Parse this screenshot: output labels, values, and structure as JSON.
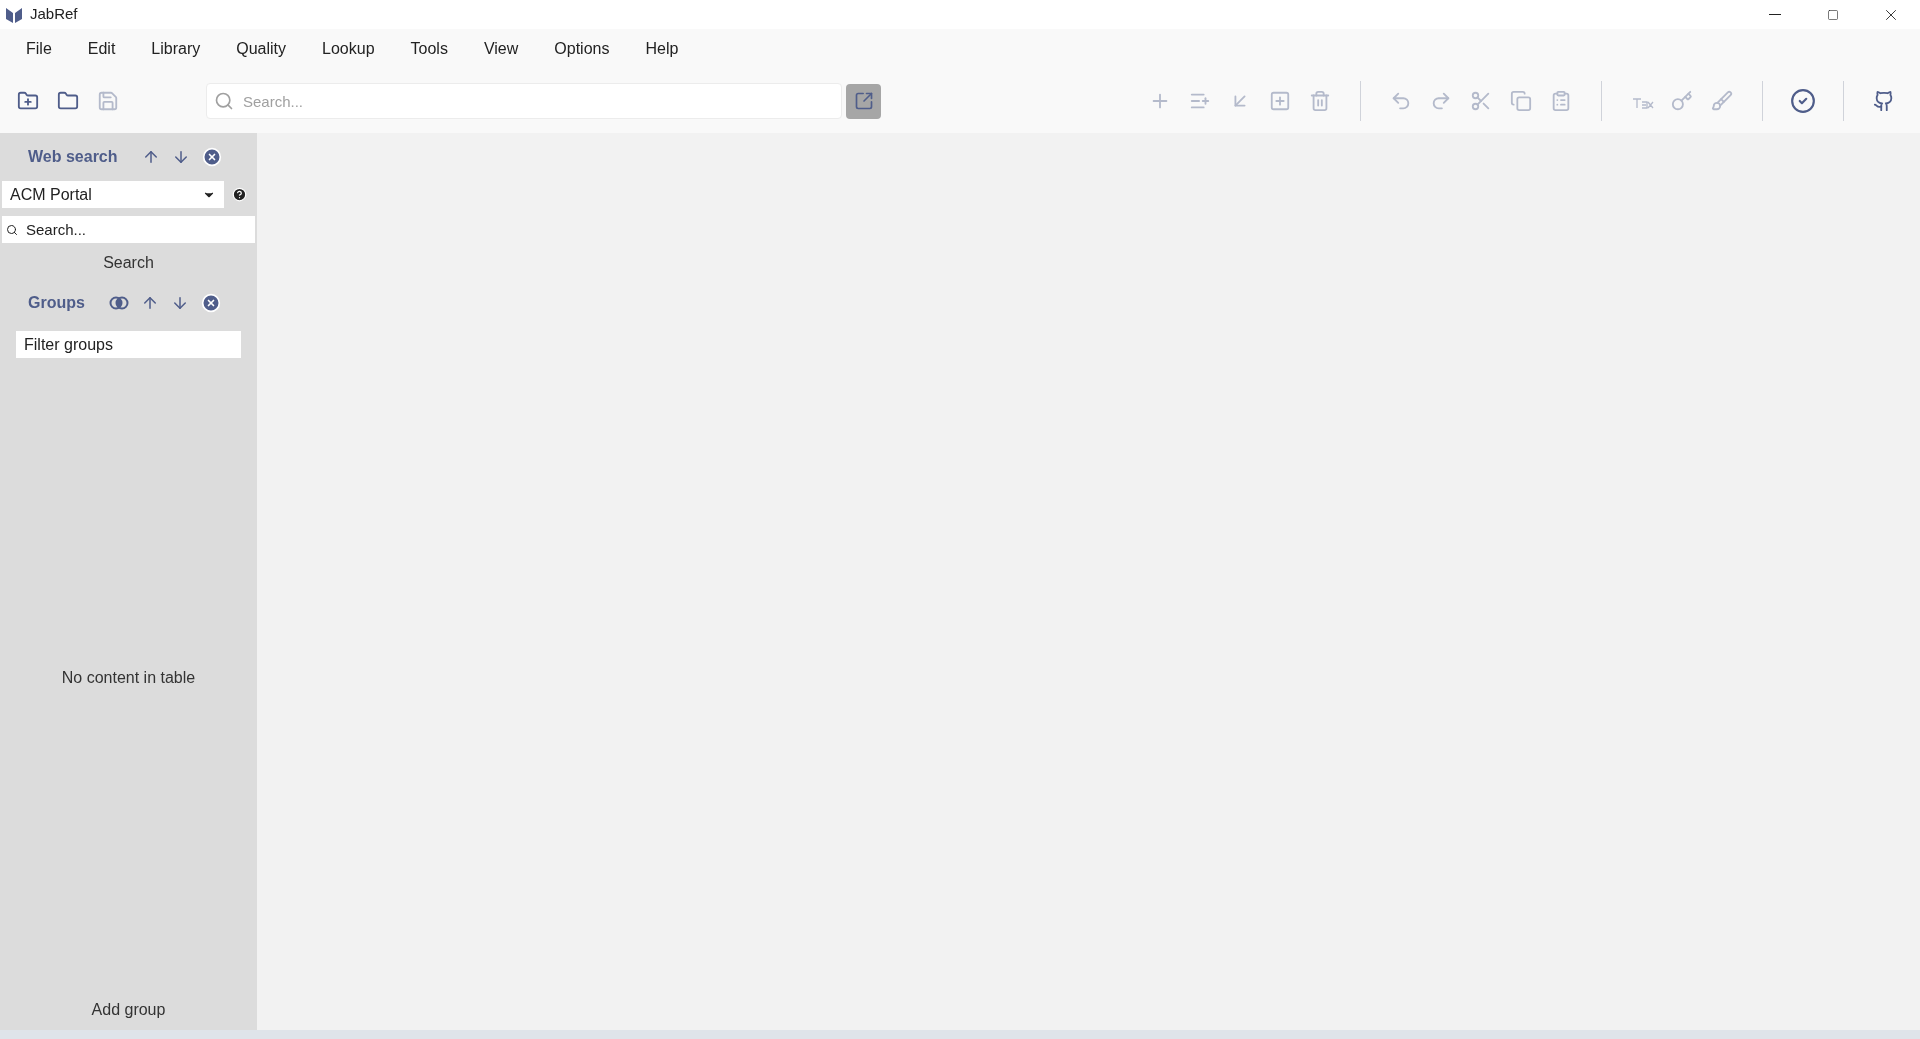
{
  "window": {
    "title": "JabRef"
  },
  "menu": [
    "File",
    "Edit",
    "Library",
    "Quality",
    "Lookup",
    "Tools",
    "View",
    "Options",
    "Help"
  ],
  "toolbar": {
    "file_buttons": [
      {
        "kind": "new-library",
        "disabled": false
      },
      {
        "kind": "open",
        "disabled": false
      },
      {
        "kind": "save",
        "disabled": true
      }
    ],
    "search": {
      "placeholder": "Search..."
    },
    "entry_buttons": [
      {
        "kind": "add",
        "disabled": true
      },
      {
        "kind": "add-list",
        "disabled": true
      },
      {
        "kind": "import",
        "disabled": true
      },
      {
        "kind": "add-box",
        "disabled": true
      },
      {
        "kind": "delete",
        "disabled": true
      }
    ],
    "edit_buttons": [
      {
        "kind": "undo",
        "disabled": true
      },
      {
        "kind": "redo",
        "disabled": true
      },
      {
        "kind": "cut",
        "disabled": true
      },
      {
        "kind": "copy",
        "disabled": true
      },
      {
        "kind": "paste",
        "disabled": true
      }
    ],
    "tool_buttons": [
      {
        "kind": "tex",
        "disabled": true
      },
      {
        "kind": "key",
        "disabled": true
      },
      {
        "kind": "cleanup",
        "disabled": true
      }
    ]
  },
  "web_search": {
    "title": "Web search",
    "fetcher": "ACM Portal",
    "search_placeholder": "Search...",
    "search_button": "Search"
  },
  "groups": {
    "title": "Groups",
    "filter_placeholder": "Filter groups",
    "empty_text": "No content in table",
    "add_button": "Add group"
  }
}
